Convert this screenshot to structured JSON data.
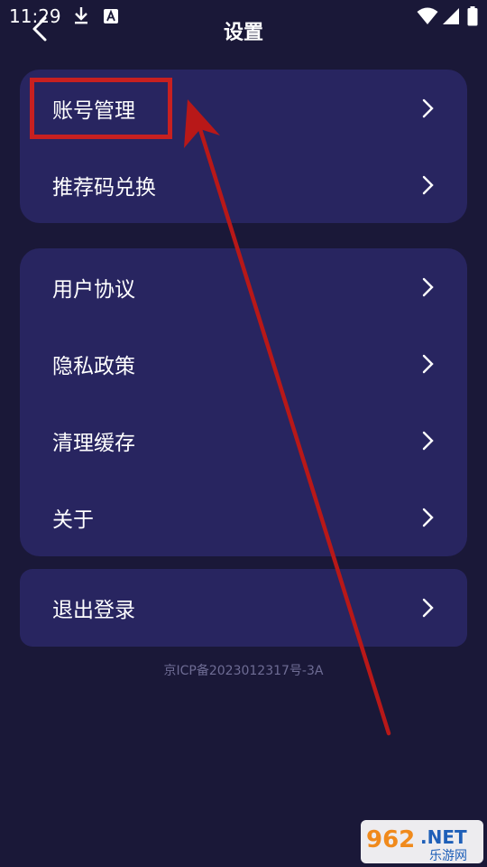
{
  "status_bar": {
    "time": "11:29",
    "icons": [
      "download-icon",
      "app-notification-icon",
      "wifi-icon",
      "signal-icon",
      "battery-icon"
    ]
  },
  "header": {
    "title": "设置",
    "back_icon": "back-arrow-icon"
  },
  "sections": {
    "account": [
      {
        "label": "账号管理"
      },
      {
        "label": "推荐码兑换"
      }
    ],
    "info": [
      {
        "label": "用户协议"
      },
      {
        "label": "隐私政策"
      },
      {
        "label": "清理缓存"
      },
      {
        "label": "关于"
      }
    ],
    "logout": [
      {
        "label": "退出登录"
      }
    ]
  },
  "footer": {
    "icp": "京ICP备2023012317号-3A"
  },
  "annotation": {
    "highlight_color": "#c82020",
    "arrow_color": "#b81818"
  },
  "watermark": {
    "brand": "962",
    "suffix": ".NET",
    "subtitle": "乐游网"
  },
  "colors": {
    "background": "#1a1838",
    "card": "#282560",
    "text": "#ffffff",
    "muted": "#6e6c94"
  }
}
